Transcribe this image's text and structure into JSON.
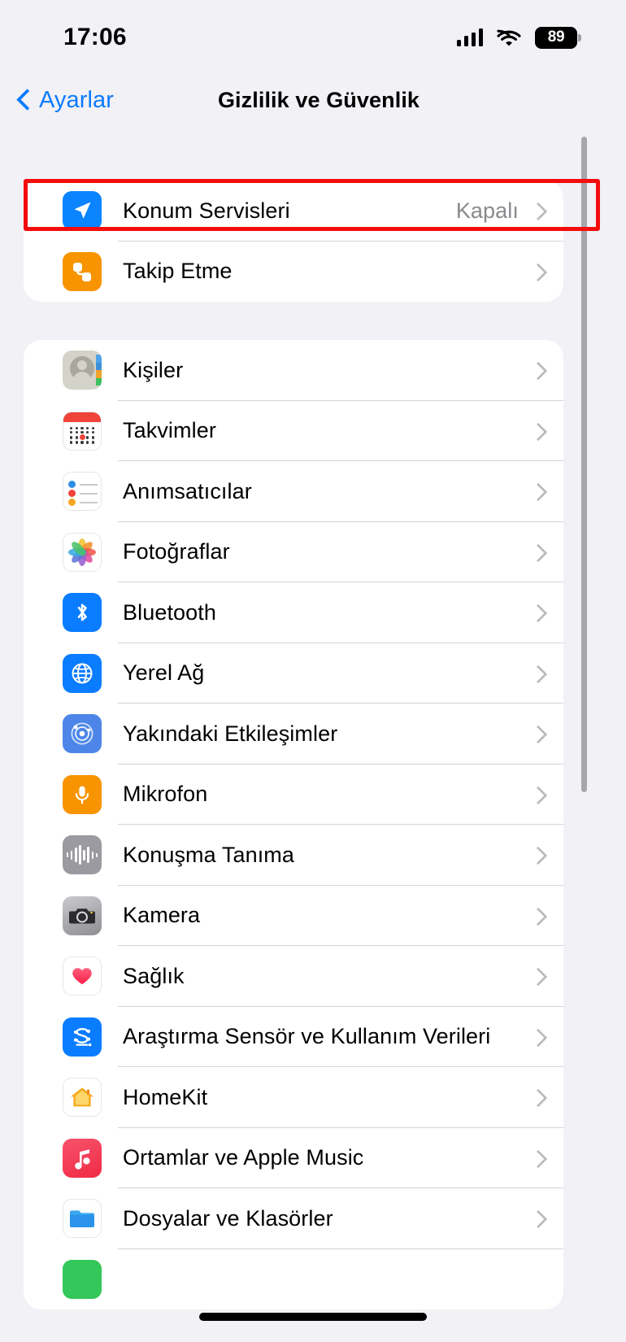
{
  "status_bar": {
    "time": "17:06",
    "battery_level": "89",
    "cellular_icon": "cellular-bars-icon",
    "wifi_icon": "wifi-icon",
    "battery_icon": "battery-icon"
  },
  "nav": {
    "back_label": "Ayarlar",
    "title": "Gizlilik ve Güvenlik",
    "back_icon": "chevron-left-icon",
    "accent_color": "#0a7cff"
  },
  "highlight": {
    "color": "#f40d0d",
    "target": "Konum Servisleri"
  },
  "sections": [
    {
      "id": "privacy-top",
      "rows": [
        {
          "label": "Konum Servisleri",
          "value": "Kapalı",
          "icon": "location-arrow-icon",
          "icon_color": "#0a84ff"
        },
        {
          "label": "Takip Etme",
          "value": "",
          "icon": "tracking-icon",
          "icon_color": "#f79400"
        }
      ]
    },
    {
      "id": "privacy-apps",
      "rows": [
        {
          "label": "Kişiler",
          "value": "",
          "icon": "contacts-icon",
          "icon_color": "#d4d3c9"
        },
        {
          "label": "Takvimler",
          "value": "",
          "icon": "calendar-icon",
          "icon_color": "#f0433a"
        },
        {
          "label": "Anımsatıcılar",
          "value": "",
          "icon": "reminders-icon",
          "icon_color": "#ffffff"
        },
        {
          "label": "Fotoğraflar",
          "value": "",
          "icon": "photos-icon",
          "icon_color": "#ffffff"
        },
        {
          "label": "Bluetooth",
          "value": "",
          "icon": "bluetooth-icon",
          "icon_color": "#0a7cff"
        },
        {
          "label": "Yerel Ağ",
          "value": "",
          "icon": "globe-network-icon",
          "icon_color": "#0a7cff"
        },
        {
          "label": "Yakındaki Etkileşimler",
          "value": "",
          "icon": "nearby-interactions-icon",
          "icon_color": "#4d86e8"
        },
        {
          "label": "Mikrofon",
          "value": "",
          "icon": "microphone-icon",
          "icon_color": "#f79400"
        },
        {
          "label": "Konuşma Tanıma",
          "value": "",
          "icon": "speech-waveform-icon",
          "icon_color": "#9a9aa0"
        },
        {
          "label": "Kamera",
          "value": "",
          "icon": "camera-icon",
          "icon_color": "#8e8e93"
        },
        {
          "label": "Sağlık",
          "value": "",
          "icon": "heart-health-icon",
          "icon_color": "#fb2b54"
        },
        {
          "label": "Araştırma Sensör ve Kullanım Verileri",
          "value": "",
          "icon": "research-sensor-icon",
          "icon_color": "#0a7cff"
        },
        {
          "label": "HomeKit",
          "value": "",
          "icon": "home-house-icon",
          "icon_color": "#f5a623"
        },
        {
          "label": "Ortamlar ve Apple Music",
          "value": "",
          "icon": "music-note-icon",
          "icon_color": "#f02a45"
        },
        {
          "label": "Dosyalar ve Klasörler",
          "value": "",
          "icon": "folder-icon",
          "icon_color": "#2196f3"
        },
        {
          "label": "",
          "value": "",
          "icon": "green-app-icon",
          "icon_color": "#34c759"
        }
      ]
    }
  ],
  "chevron_icon": "chevron-right-icon",
  "scrollbar": {
    "name": "vertical-scrollbar"
  },
  "home_indicator": {
    "name": "home-indicator"
  }
}
